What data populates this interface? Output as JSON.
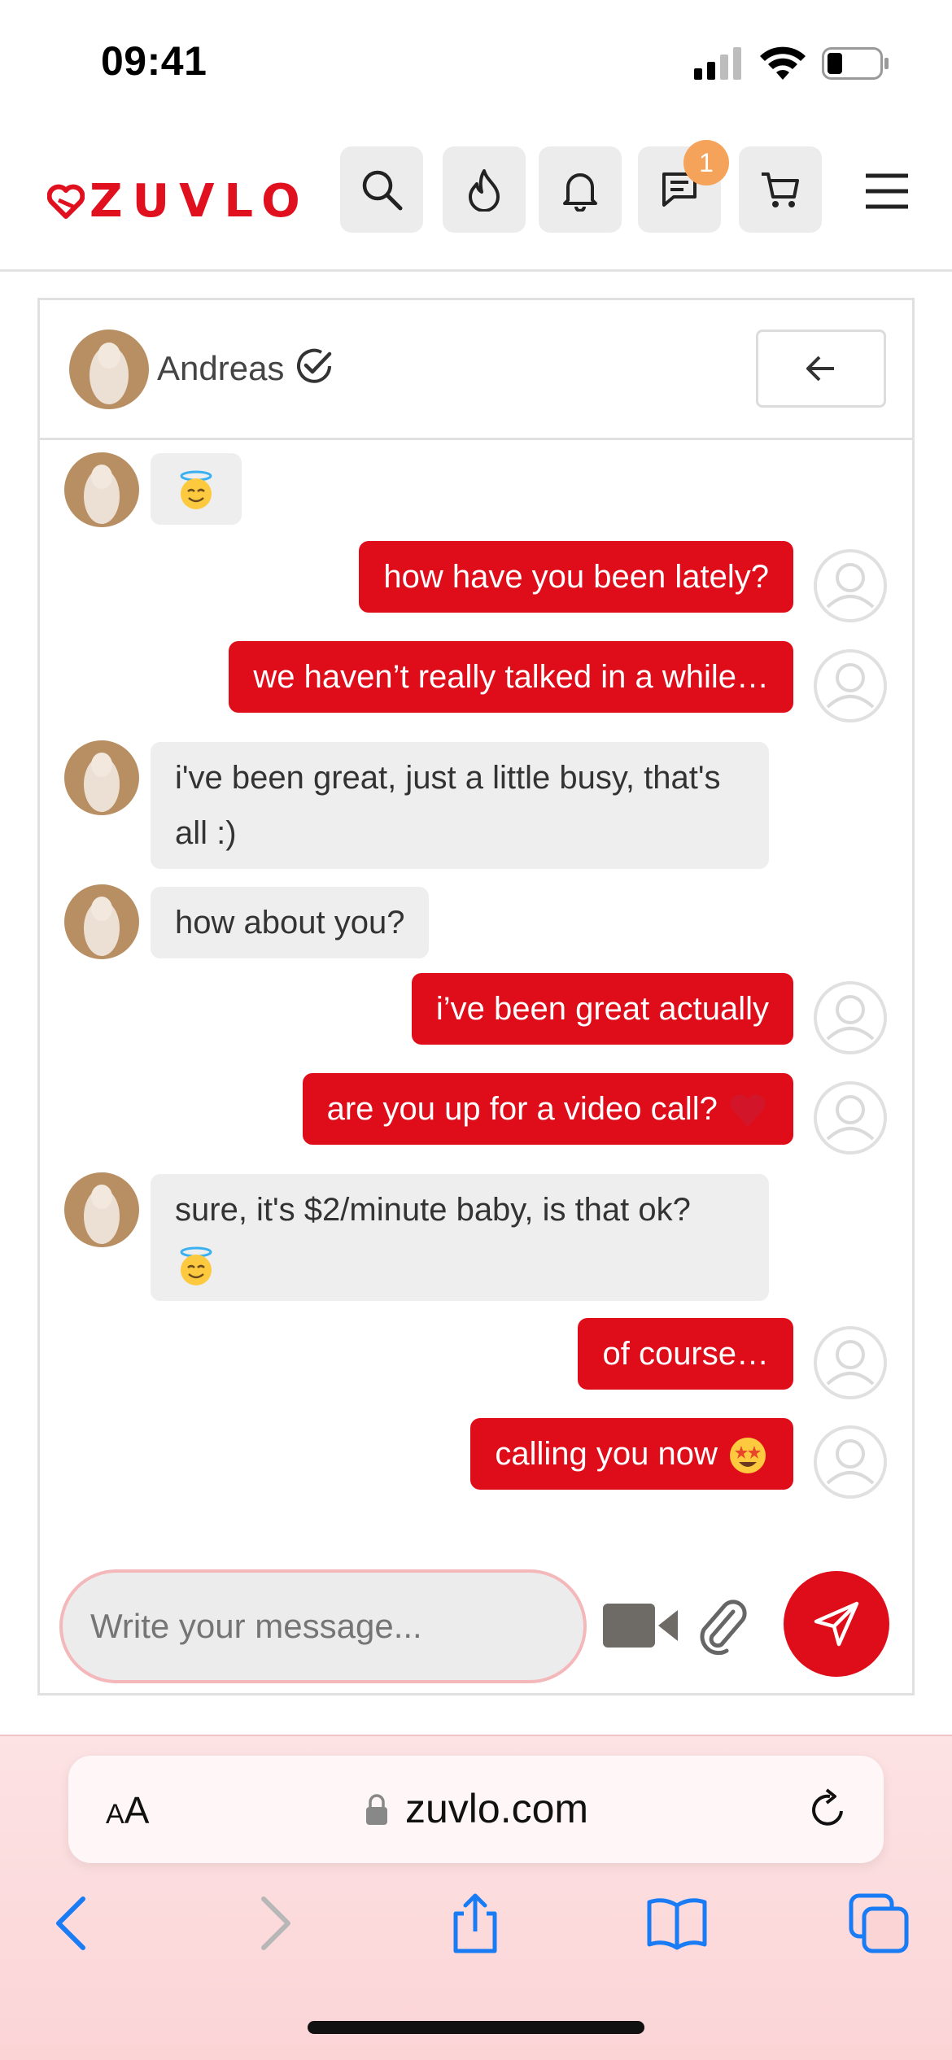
{
  "status_bar": {
    "time": "09:41"
  },
  "header": {
    "logo_text": "ZUVLO",
    "messages_badge": "1",
    "buttons": [
      "search-icon",
      "flame-icon",
      "bell-icon",
      "chat-icon",
      "cart-icon",
      "menu-icon"
    ]
  },
  "chat": {
    "contact_name": "Andreas",
    "messages": [
      {
        "from": "them",
        "text": "",
        "emoji": "smiling-face-with-halo"
      },
      {
        "from": "me",
        "text": "how have you been lately?"
      },
      {
        "from": "me",
        "text": "we haven’t really talked in a while…"
      },
      {
        "from": "them",
        "text": "i've been great, just a little busy, that's all :)"
      },
      {
        "from": "them",
        "text": "how about you?"
      },
      {
        "from": "me",
        "text": "i’ve been great actually"
      },
      {
        "from": "me",
        "text": "are you up for a video call?",
        "emoji": "red-heart"
      },
      {
        "from": "them",
        "text": "sure, it's $2/minute baby, is that ok?",
        "emoji": "smiling-face-with-halo"
      },
      {
        "from": "me",
        "text": "of course…"
      },
      {
        "from": "me",
        "text": "calling you now",
        "emoji": "star-struck"
      }
    ],
    "composer": {
      "placeholder": "Write your message..."
    }
  },
  "browser": {
    "aa_label_small": "A",
    "aa_label_large": "A",
    "url": "zuvlo.com"
  },
  "colors": {
    "brand": "#df0d1a",
    "badge": "#f5a35a",
    "incoming_bubble": "#eeeeee"
  }
}
